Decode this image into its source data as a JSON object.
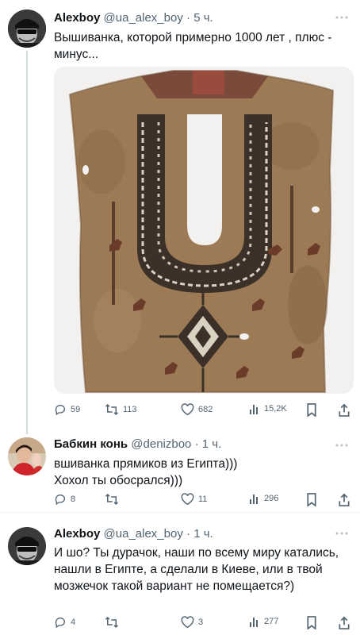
{
  "tweets": [
    {
      "name": "Alexboy",
      "handle": "@ua_alex_boy",
      "time": "5 ч.",
      "text": "Вышиванка, которой примерно 1000 лет , плюс - минус...",
      "image_description_alt": "",
      "stats": {
        "replies": "59",
        "retweets": "113",
        "likes": "682",
        "views": "15,2K"
      }
    },
    {
      "name": "Бабкин конь",
      "handle": "@denizboo",
      "time": "1 ч.",
      "text": "вшиванка прямиков из Египта)))\nХохол ты обосрался)))",
      "stats": {
        "replies": "8",
        "retweets": "",
        "likes": "11",
        "views": "296"
      }
    },
    {
      "name": "Alexboy",
      "handle": "@ua_alex_boy",
      "time": "1 ч.",
      "text": "И шо? Ты дурачок, наши по всему миру катались, нашли в Египте, а сделали в Киеве, или в твой мозжечок такой вариант не помещается?)",
      "stats": {
        "replies": "4",
        "retweets": "",
        "likes": "3",
        "views": "277"
      }
    }
  ],
  "icons": {
    "more": "more-icon",
    "reply": "reply-icon",
    "retweet": "retweet-icon",
    "like": "like-icon",
    "views": "views-icon",
    "bookmark": "bookmark-icon",
    "share": "share-icon"
  },
  "colors": {
    "text": "#0f1419",
    "secondary": "#536471",
    "divider": "#eff3f4"
  }
}
